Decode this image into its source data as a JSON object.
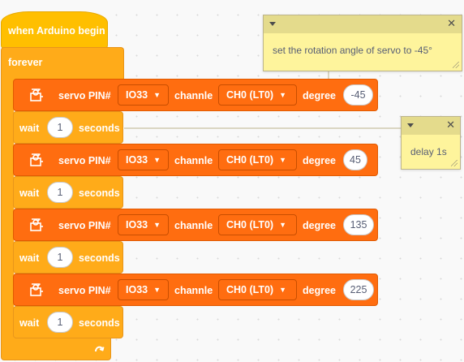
{
  "hat": {
    "label": "when Arduino begin"
  },
  "forever": {
    "label": "forever",
    "loop_icon": "loop-arrow-icon"
  },
  "servo_blocks": [
    {
      "label": "servo PIN#",
      "pin": "IO33",
      "channel_label": "channle",
      "channel": "CH0 (LT0)",
      "degree_label": "degree",
      "degree": "-45"
    },
    {
      "label": "servo PIN#",
      "pin": "IO33",
      "channel_label": "channle",
      "channel": "CH0 (LT0)",
      "degree_label": "degree",
      "degree": "45"
    },
    {
      "label": "servo PIN#",
      "pin": "IO33",
      "channel_label": "channle",
      "channel": "CH0 (LT0)",
      "degree_label": "degree",
      "degree": "135"
    },
    {
      "label": "servo PIN#",
      "pin": "IO33",
      "channel_label": "channle",
      "channel": "CH0 (LT0)",
      "degree_label": "degree",
      "degree": "225"
    }
  ],
  "wait_blocks": [
    {
      "label": "wait",
      "value": "1",
      "unit": "seconds"
    },
    {
      "label": "wait",
      "value": "1",
      "unit": "seconds"
    },
    {
      "label": "wait",
      "value": "1",
      "unit": "seconds"
    },
    {
      "label": "wait",
      "value": "1",
      "unit": "seconds"
    }
  ],
  "comments": [
    {
      "text": "set the rotation angle of servo to -45°"
    },
    {
      "text": "delay 1s"
    }
  ],
  "colors": {
    "hat": "#ffbf00",
    "control": "#ffab19",
    "servo": "#ff6d10",
    "comment": "#fef49c",
    "comment_header": "#e4db8c"
  }
}
